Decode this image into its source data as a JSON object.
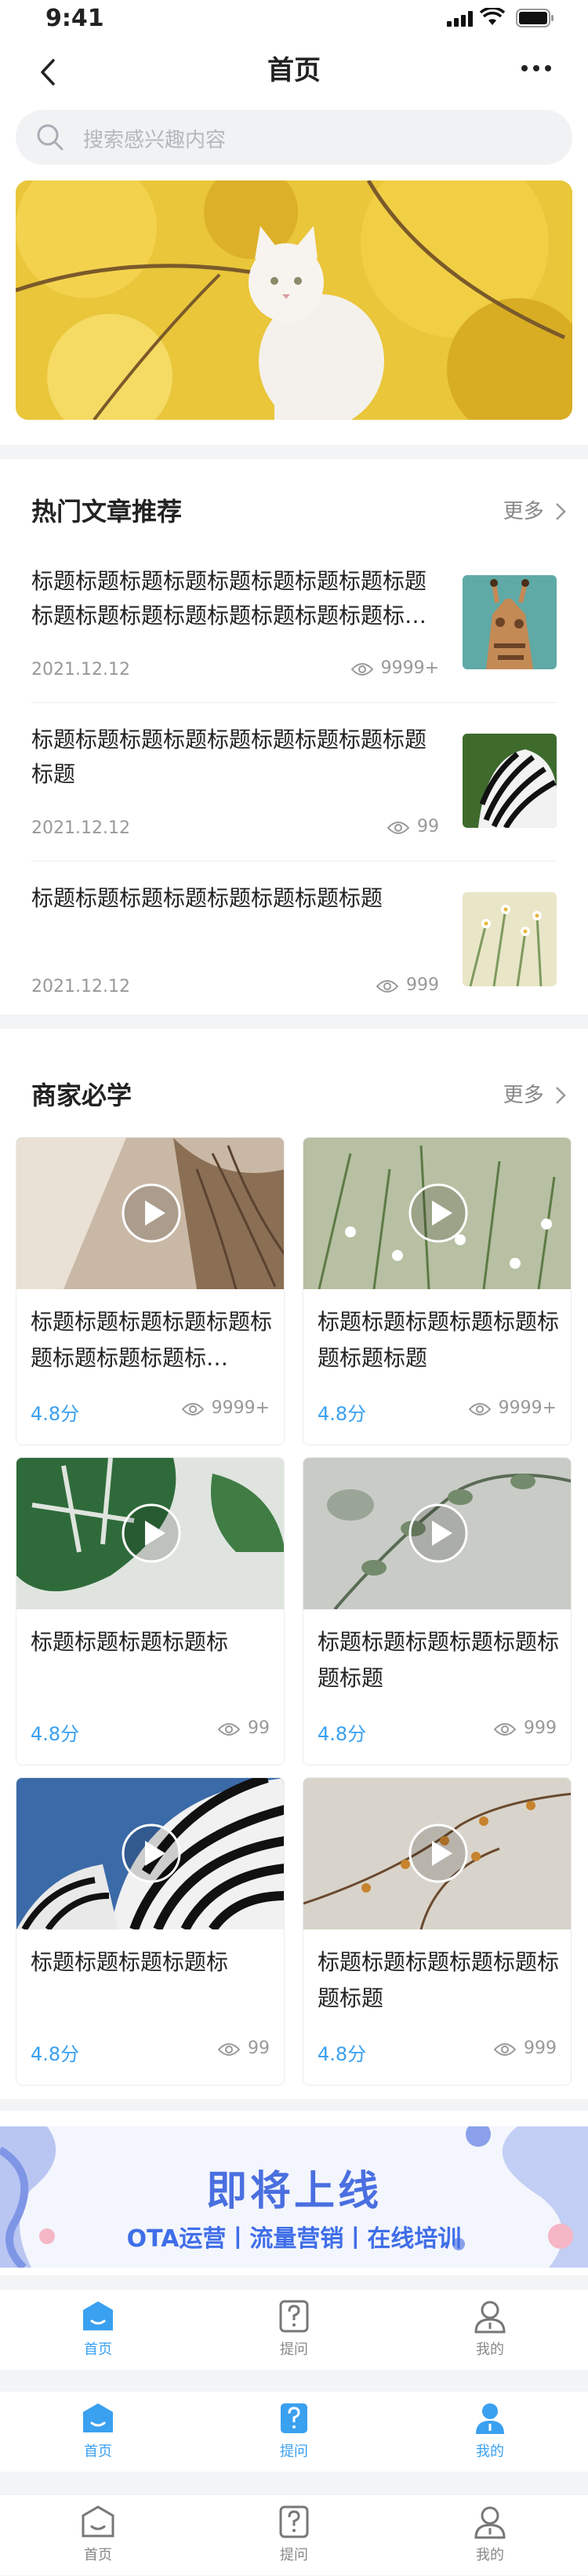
{
  "status_bar": {
    "time": "9:41"
  },
  "nav": {
    "title": "首页"
  },
  "search": {
    "placeholder": "搜索感兴趣内容"
  },
  "hot_articles": {
    "title": "热门文章推荐",
    "more": "更多",
    "items": [
      {
        "title": "标题标题标题标题标题标题标题标题标题标题标题标题标题标题标题标题标题标…",
        "date": "2021.12.12",
        "views": "9999+"
      },
      {
        "title": "标题标题标题标题标题标题标题标题标题标题",
        "date": "2021.12.12",
        "views": "99"
      },
      {
        "title": "标题标题标题标题标题标题标题标题",
        "date": "2021.12.12",
        "views": "999"
      }
    ]
  },
  "merchant": {
    "title": "商家必学",
    "more": "更多",
    "cards": [
      {
        "title": "标题标题标题标题标题标题标题标题标题标…",
        "score": "4.8分",
        "views": "9999+"
      },
      {
        "title": "标题标题标题标题标题标题标题标题",
        "score": "4.8分",
        "views": "9999+"
      },
      {
        "title": "标题标题标题标题标",
        "score": "4.8分",
        "views": "99"
      },
      {
        "title": "标题标题标题标题标题标题标题",
        "score": "4.8分",
        "views": "999"
      },
      {
        "title": "标题标题标题标题标",
        "score": "4.8分",
        "views": "99"
      },
      {
        "title": "标题标题标题标题标题标题标题",
        "score": "4.8分",
        "views": "999"
      }
    ]
  },
  "promo": {
    "headline": "即将上线",
    "subline": "OTA运营丨流量营销丨在线培训"
  },
  "tabbars": [
    {
      "tabs": [
        {
          "label": "首页"
        },
        {
          "label": "提问"
        },
        {
          "label": "我的"
        }
      ]
    },
    {
      "tabs": [
        {
          "label": "首页"
        },
        {
          "label": "提问"
        },
        {
          "label": "我的"
        }
      ]
    },
    {
      "tabs": [
        {
          "label": "首页"
        },
        {
          "label": "提问"
        },
        {
          "label": "我的"
        }
      ]
    }
  ],
  "colors": {
    "accent": "#3aa0f0",
    "promo_blue": "#4a6fe0",
    "page_bg": "#f3f4f6"
  }
}
